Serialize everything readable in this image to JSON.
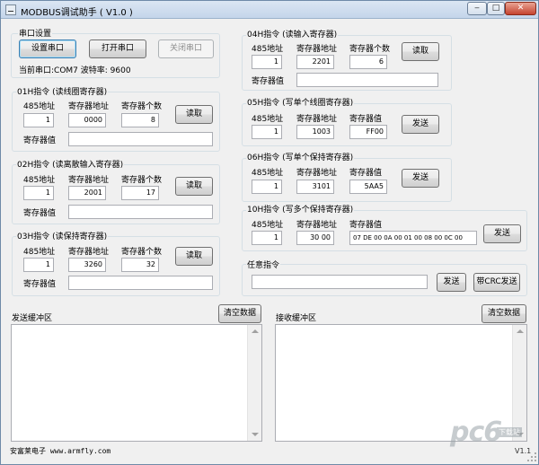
{
  "window": {
    "title": "MODBUS调试助手 ( V1.0 )",
    "min_glyph": "‒",
    "max_glyph": "□",
    "close_glyph": "✕"
  },
  "serial": {
    "group_title": "串口设置",
    "setup_button": "设置串口",
    "open_button": "打开串口",
    "close_button": "关闭串口",
    "status": "当前串口:COM7 波特率: 9600"
  },
  "labels": {
    "addr485": "485地址",
    "reg_addr": "寄存器地址",
    "reg_count": "寄存器个数",
    "reg_value": "寄存器值",
    "read": "读取",
    "send": "发送"
  },
  "cmd01": {
    "title": "01H指令 (读线圈寄存器)",
    "addr485": "1",
    "reg_addr": "0000",
    "reg_count": "8",
    "reg_value": ""
  },
  "cmd02": {
    "title": "02H指令 (读离散输入寄存器)",
    "addr485": "1",
    "reg_addr": "2001",
    "reg_count": "17",
    "reg_value": ""
  },
  "cmd03": {
    "title": "03H指令 (读保持寄存器)",
    "addr485": "1",
    "reg_addr": "3260",
    "reg_count": "32",
    "reg_value": ""
  },
  "cmd04": {
    "title": "04H指令 (读输入寄存器)",
    "addr485": "1",
    "reg_addr": "2201",
    "reg_count": "6",
    "reg_value": ""
  },
  "cmd05": {
    "title": "05H指令 (写单个线圈寄存器)",
    "addr485": "1",
    "reg_addr": "1003",
    "reg_value": "FF00"
  },
  "cmd06": {
    "title": "06H指令 (写单个保持寄存器)",
    "addr485": "1",
    "reg_addr": "3101",
    "reg_value": "5AA5"
  },
  "cmd10": {
    "title": "10H指令 (写多个保持寄存器)",
    "addr485": "1",
    "reg_addr": "30 00",
    "reg_value": "07 DE 00 0A 00 01 00 08 00 0C 00"
  },
  "custom": {
    "title": "任意指令",
    "value": "",
    "send_button": "发送",
    "send_crc_button": "带CRC发送"
  },
  "send_buffer": {
    "label": "发送缓冲区",
    "clear_button": "清空数据"
  },
  "recv_buffer": {
    "label": "接收缓冲区",
    "clear_button": "清空数据"
  },
  "footer": {
    "company": "安富莱电子 www.armfly.com",
    "version": "V1.1"
  },
  "watermark": {
    "text": "pc6",
    "sub": "下载站"
  },
  "colors": {
    "title_bar": "#c4d5ea",
    "close_button": "#c5432f",
    "background": "#f0f0f0"
  }
}
